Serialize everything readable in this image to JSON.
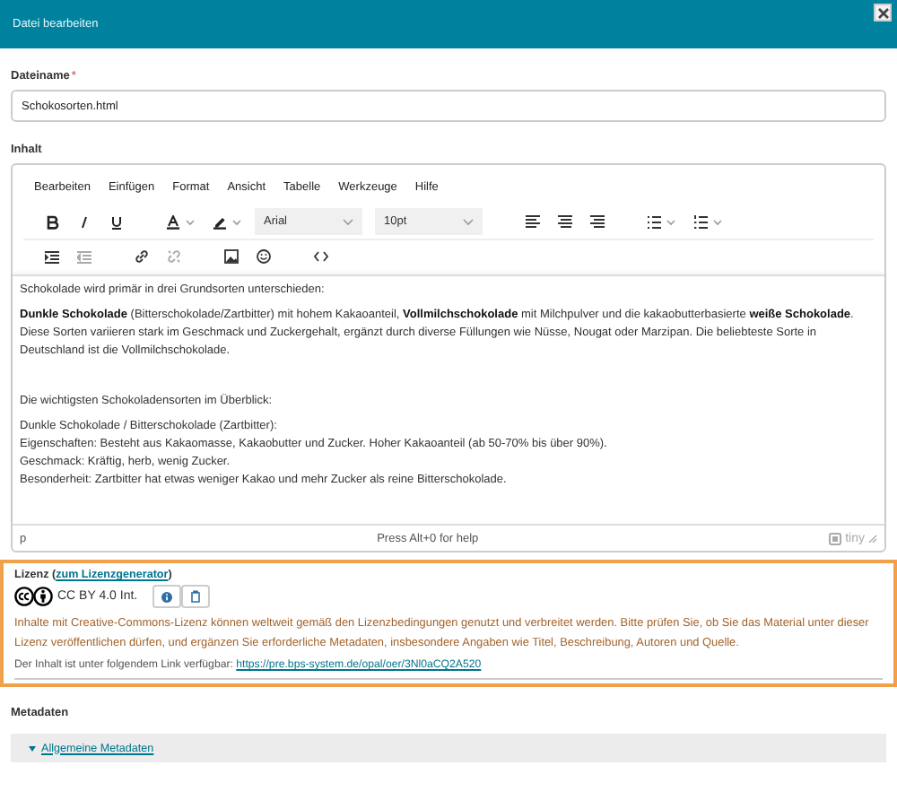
{
  "dialog": {
    "title": "Datei bearbeiten"
  },
  "filename": {
    "label": "Dateiname",
    "required_mark": "*",
    "value": "Schokosorten.html"
  },
  "content_label": "Inhalt",
  "editor": {
    "menu": [
      "Bearbeiten",
      "Einfügen",
      "Format",
      "Ansicht",
      "Tabelle",
      "Werkzeuge",
      "Hilfe"
    ],
    "font": "Arial",
    "size": "10pt",
    "paragraphs": [
      {
        "spacer": false,
        "lines": [
          "Schokolade wird primär in drei Grundsorten unterschieden:"
        ]
      },
      {
        "spacer": false,
        "lines": [
          "**Dunkle Schokolade** (Bitterschokolade/Zartbitter) mit hohem Kakaoanteil, **Vollmilchschokolade** mit Milchpulver und die kakaobutterbasierte **weiße Schokolade**. Diese Sorten variieren stark im Geschmack und Zuckergehalt, ergänzt durch diverse Füllungen wie Nüsse, Nougat oder Marzipan. Die beliebteste Sorte in Deutschland ist die Vollmilchschokolade."
        ]
      },
      {
        "spacer": true,
        "lines": [
          "Die wichtigsten Schokoladensorten im Überblick:"
        ]
      },
      {
        "spacer": false,
        "lines": [
          "Dunkle Schokolade / Bitterschokolade (Zartbitter):",
          "Eigenschaften: Besteht aus Kakaomasse, Kakaobutter und Zucker. Hoher Kakaoanteil (ab 50-70% bis über 90%).",
          "Geschmack: Kräftig, herb, wenig Zucker.",
          "Besonderheit: Zartbitter hat etwas weniger Kakao und mehr Zucker als reine Bitterschokolade."
        ]
      }
    ],
    "path": "p",
    "help": "Press Alt+0 for help",
    "brand": "tiny"
  },
  "license": {
    "before": "Lizenz (",
    "link": "zum Lizenzgenerator",
    "after": ")",
    "badge": "CC BY 4.0 Int.",
    "notice": "Inhalte mit Creative-Commons-Lizenz können weltweit gemäß den Lizenzbedingungen genutzt und verbreitet werden. Bitte prüfen Sie, ob Sie das Material unter dieser Lizenz veröffentlichen dürfen, und ergänzen Sie erforderliche Metadaten, insbesondere Angaben wie Titel, Beschreibung, Autoren und Quelle.",
    "url_label": "Der Inhalt ist unter folgendem Link verfügbar:",
    "url": "https://pre.bps-system.de/opal/oer/3Nl0aCQ2A520"
  },
  "metadata": {
    "heading": "Metadaten",
    "section": "Allgemeine Metadaten"
  }
}
